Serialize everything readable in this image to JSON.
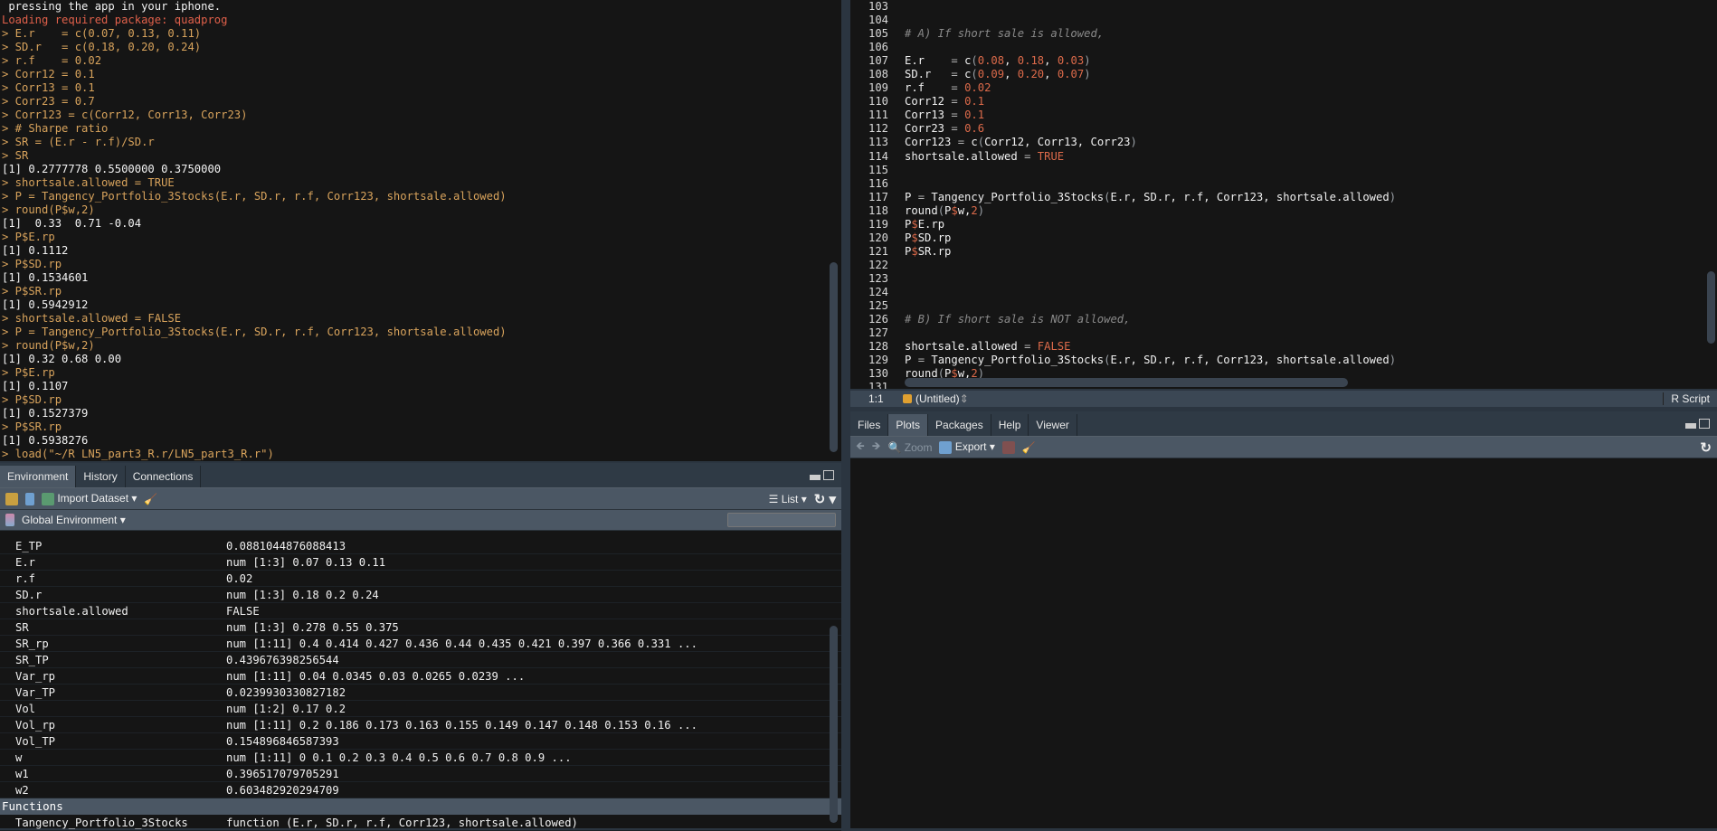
{
  "console": {
    "lines": [
      [
        "out",
        " pressing the app in your iphone."
      ],
      [
        "err",
        "Loading required package: quadprog"
      ],
      [
        "cmd",
        "> E.r    = c(0.07, 0.13, 0.11)"
      ],
      [
        "cmd",
        "> SD.r   = c(0.18, 0.20, 0.24)"
      ],
      [
        "cmd",
        "> r.f    = 0.02"
      ],
      [
        "cmd",
        "> Corr12 = 0.1"
      ],
      [
        "cmd",
        "> Corr13 = 0.1"
      ],
      [
        "cmd",
        "> Corr23 = 0.7"
      ],
      [
        "cmd",
        "> Corr123 = c(Corr12, Corr13, Corr23)"
      ],
      [
        "cmd",
        "> # Sharpe ratio"
      ],
      [
        "cmd",
        "> SR = (E.r - r.f)/SD.r"
      ],
      [
        "cmd",
        "> SR"
      ],
      [
        "out",
        "[1] 0.2777778 0.5500000 0.3750000"
      ],
      [
        "cmd",
        "> shortsale.allowed = TRUE"
      ],
      [
        "cmd",
        "> P = Tangency_Portfolio_3Stocks(E.r, SD.r, r.f, Corr123, shortsale.allowed)"
      ],
      [
        "cmd",
        "> round(P$w,2)"
      ],
      [
        "out",
        "[1]  0.33  0.71 -0.04"
      ],
      [
        "cmd",
        "> P$E.rp"
      ],
      [
        "out",
        "[1] 0.1112"
      ],
      [
        "cmd",
        "> P$SD.rp"
      ],
      [
        "out",
        "[1] 0.1534601"
      ],
      [
        "cmd",
        "> P$SR.rp"
      ],
      [
        "out",
        "[1] 0.5942912"
      ],
      [
        "cmd",
        "> shortsale.allowed = FALSE"
      ],
      [
        "cmd",
        "> P = Tangency_Portfolio_3Stocks(E.r, SD.r, r.f, Corr123, shortsale.allowed)"
      ],
      [
        "cmd",
        "> round(P$w,2)"
      ],
      [
        "out",
        "[1] 0.32 0.68 0.00"
      ],
      [
        "cmd",
        "> P$E.rp"
      ],
      [
        "out",
        "[1] 0.1107"
      ],
      [
        "cmd",
        "> P$SD.rp"
      ],
      [
        "out",
        "[1] 0.1527379"
      ],
      [
        "cmd",
        "> P$SR.rp"
      ],
      [
        "out",
        "[1] 0.5938276"
      ],
      [
        "cmd",
        "> load(\"~/R LN5_part3_R.r/LN5_part3_R.r\")"
      ]
    ]
  },
  "env": {
    "tabs": [
      "Environment",
      "History",
      "Connections"
    ],
    "toolbar": {
      "import": "Import Dataset",
      "list": "List"
    },
    "scope": "Global Environment",
    "search_placeholder": "",
    "rows": [
      [
        "E_TP",
        "0.0881044876088413"
      ],
      [
        "E.r",
        "num [1:3] 0.07 0.13 0.11"
      ],
      [
        "r.f",
        "0.02"
      ],
      [
        "SD.r",
        "num [1:3] 0.18 0.2 0.24"
      ],
      [
        "shortsale.allowed",
        "FALSE"
      ],
      [
        "SR",
        "num [1:3] 0.278 0.55 0.375"
      ],
      [
        "SR_rp",
        "num [1:11] 0.4 0.414 0.427 0.436 0.44 0.435 0.421 0.397 0.366 0.331 ..."
      ],
      [
        "SR_TP",
        "0.439676398256544"
      ],
      [
        "Var_rp",
        "num [1:11] 0.04 0.0345 0.03 0.0265 0.0239 ..."
      ],
      [
        "Var_TP",
        "0.0239930330827182"
      ],
      [
        "Vol",
        "num [1:2] 0.17 0.2"
      ],
      [
        "Vol_rp",
        "num [1:11] 0.2 0.186 0.173 0.163 0.155 0.149 0.147 0.148 0.153 0.16 ..."
      ],
      [
        "Vol_TP",
        "0.154896846587393"
      ],
      [
        "w",
        "num [1:11] 0 0.1 0.2 0.3 0.4 0.5 0.6 0.7 0.8 0.9 ..."
      ],
      [
        "w1",
        "0.396517079705291"
      ],
      [
        "w2",
        "0.603482920294709"
      ]
    ],
    "functions_header": "Functions",
    "functions": [
      [
        "Tangency_Portfolio_3Stocks",
        "function (E.r, SD.r, r.f, Corr123, shortsale.allowed)"
      ]
    ]
  },
  "editor": {
    "lines": [
      [
        103,
        []
      ],
      [
        104,
        []
      ],
      [
        105,
        [
          [
            "# A) If short sale is allowed,",
            "com"
          ]
        ]
      ],
      [
        106,
        []
      ],
      [
        107,
        [
          [
            "E.r    ",
            ""
          ],
          [
            "= ",
            "op"
          ],
          [
            "c",
            ""
          ],
          [
            "(",
            "par"
          ],
          [
            "0.08",
            "num"
          ],
          [
            ", ",
            ""
          ],
          [
            "0.18",
            "num"
          ],
          [
            ", ",
            ""
          ],
          [
            "0.03",
            "num"
          ],
          [
            ")",
            "par"
          ]
        ]
      ],
      [
        108,
        [
          [
            "SD.r   ",
            ""
          ],
          [
            "= ",
            "op"
          ],
          [
            "c",
            ""
          ],
          [
            "(",
            "par"
          ],
          [
            "0.09",
            "num"
          ],
          [
            ", ",
            ""
          ],
          [
            "0.20",
            "num"
          ],
          [
            ", ",
            ""
          ],
          [
            "0.07",
            "num"
          ],
          [
            ")",
            "par"
          ]
        ]
      ],
      [
        109,
        [
          [
            "r.f    ",
            ""
          ],
          [
            "= ",
            "op"
          ],
          [
            "0.02",
            "num"
          ]
        ]
      ],
      [
        110,
        [
          [
            "Corr12 ",
            ""
          ],
          [
            "= ",
            "op"
          ],
          [
            "0.1",
            "num"
          ]
        ]
      ],
      [
        111,
        [
          [
            "Corr13 ",
            ""
          ],
          [
            "= ",
            "op"
          ],
          [
            "0.1",
            "num"
          ]
        ]
      ],
      [
        112,
        [
          [
            "Corr23 ",
            ""
          ],
          [
            "= ",
            "op"
          ],
          [
            "0.6",
            "num"
          ]
        ]
      ],
      [
        113,
        [
          [
            "Corr123 ",
            ""
          ],
          [
            "= ",
            "op"
          ],
          [
            "c",
            ""
          ],
          [
            "(",
            "par"
          ],
          [
            "Corr12, Corr13, Corr23",
            ""
          ],
          [
            ")",
            "par"
          ]
        ]
      ],
      [
        114,
        [
          [
            "shortsale.allowed ",
            ""
          ],
          [
            "= ",
            "op"
          ],
          [
            "TRUE",
            "num"
          ]
        ]
      ],
      [
        115,
        []
      ],
      [
        116,
        []
      ],
      [
        117,
        [
          [
            "P ",
            ""
          ],
          [
            "= ",
            "op"
          ],
          [
            "Tangency_Portfolio_3Stocks",
            ""
          ],
          [
            "(",
            "par"
          ],
          [
            "E.r, SD.r, r.f, Corr123, shortsale.allowed",
            ""
          ],
          [
            ")",
            "par"
          ]
        ]
      ],
      [
        118,
        [
          [
            "round",
            ""
          ],
          [
            "(",
            "par"
          ],
          [
            "P",
            ""
          ],
          [
            "$",
            "num"
          ],
          [
            "w,",
            ""
          ],
          [
            "2",
            "num"
          ],
          [
            ")",
            "par"
          ]
        ]
      ],
      [
        119,
        [
          [
            "P",
            ""
          ],
          [
            "$",
            "num"
          ],
          [
            "E.rp",
            ""
          ]
        ]
      ],
      [
        120,
        [
          [
            "P",
            ""
          ],
          [
            "$",
            "num"
          ],
          [
            "SD.rp",
            ""
          ]
        ]
      ],
      [
        121,
        [
          [
            "P",
            ""
          ],
          [
            "$",
            "num"
          ],
          [
            "SR.rp",
            ""
          ]
        ]
      ],
      [
        122,
        []
      ],
      [
        123,
        []
      ],
      [
        124,
        []
      ],
      [
        125,
        []
      ],
      [
        126,
        [
          [
            "# B) If short sale is NOT allowed,",
            "com"
          ]
        ]
      ],
      [
        127,
        []
      ],
      [
        128,
        [
          [
            "shortsale.allowed ",
            ""
          ],
          [
            "= ",
            "op"
          ],
          [
            "FALSE",
            "num"
          ]
        ]
      ],
      [
        129,
        [
          [
            "P ",
            ""
          ],
          [
            "= ",
            "op"
          ],
          [
            "Tangency_Portfolio_3Stocks",
            ""
          ],
          [
            "(",
            "par"
          ],
          [
            "E.r, SD.r, r.f, Corr123, shortsale.allowed",
            ""
          ],
          [
            ")",
            "par"
          ]
        ]
      ],
      [
        130,
        [
          [
            "round",
            ""
          ],
          [
            "(",
            "par"
          ],
          [
            "P",
            ""
          ],
          [
            "$",
            "num"
          ],
          [
            "w,",
            ""
          ],
          [
            "2",
            "num"
          ],
          [
            ")",
            "par"
          ]
        ]
      ],
      [
        131,
        []
      ]
    ],
    "status": {
      "position": "1:1",
      "scope": "(Untitled)",
      "filetype": "R Script"
    }
  },
  "files": {
    "tabs": [
      "Files",
      "Plots",
      "Packages",
      "Help",
      "Viewer"
    ],
    "active": "Plots",
    "toolbar": {
      "zoom": "Zoom",
      "export": "Export"
    }
  }
}
